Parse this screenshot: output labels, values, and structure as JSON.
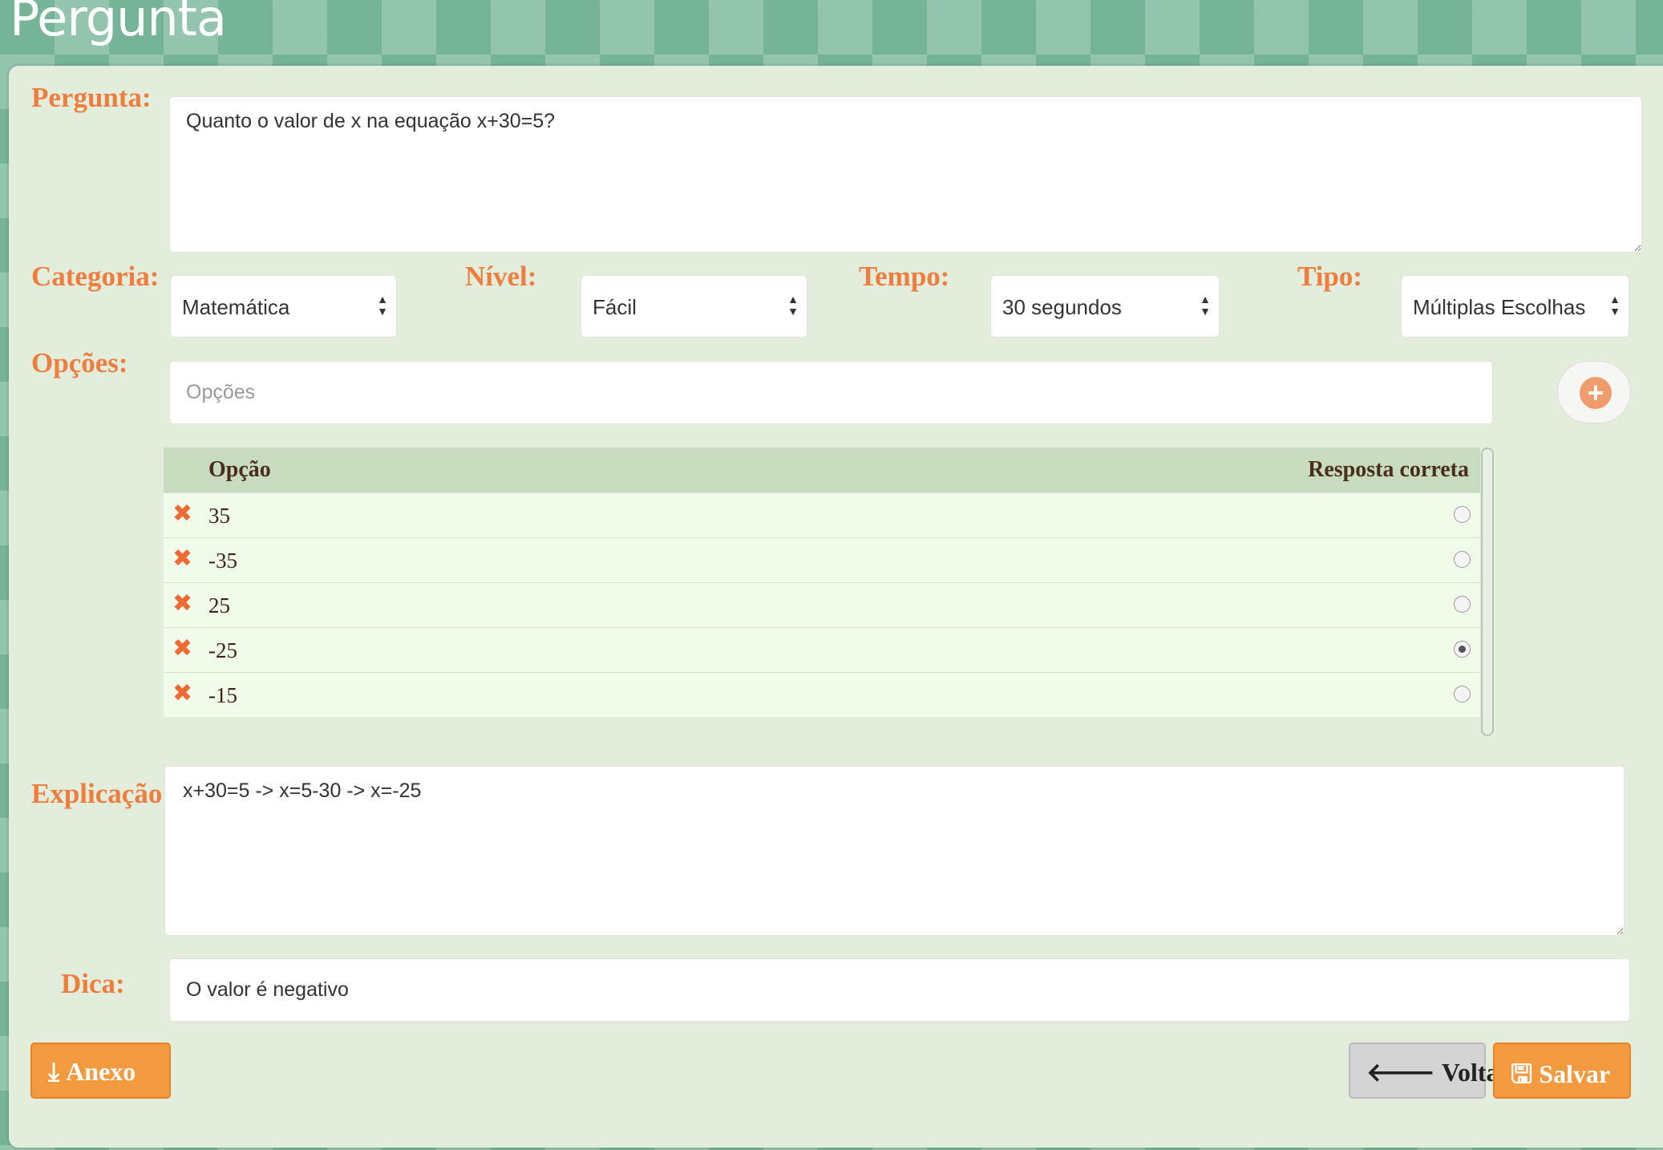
{
  "page": {
    "title": "Pergunta"
  },
  "question": {
    "label": "Pergunta:",
    "value": "Quanto o valor de x na equação x+30=5?"
  },
  "category": {
    "label": "Categoria:",
    "value": "Matemática"
  },
  "level": {
    "label": "Nível:",
    "value": "Fácil"
  },
  "time": {
    "label": "Tempo:",
    "value": "30 segundos"
  },
  "type": {
    "label": "Tipo:",
    "value": "Múltiplas Escolhas"
  },
  "options": {
    "label": "Opções:",
    "placeholder": "Opções",
    "add_icon": "plus-circle-icon",
    "delete_icon": "times-icon",
    "table": {
      "col_option": "Opção",
      "col_correct": "Resposta correta",
      "rows": [
        {
          "value": "35",
          "correct": false
        },
        {
          "value": "-35",
          "correct": false
        },
        {
          "value": "25",
          "correct": false
        },
        {
          "value": "-25",
          "correct": true
        },
        {
          "value": "-15",
          "correct": false
        }
      ]
    }
  },
  "explanation": {
    "label": "Explicação:",
    "value": "x+30=5 -> x=5-30 -> x=-25"
  },
  "hint": {
    "label": "Dica:",
    "value": "O valor é negativo"
  },
  "buttons": {
    "attachment": "Anexo",
    "attachment_icon": "download-icon",
    "back": "Voltar",
    "back_icon": "arrow-left-icon",
    "save": "Salvar",
    "save_icon": "floppy-disk-icon"
  },
  "colors": {
    "accent": "#ee7d3e",
    "panel": "#e2eedb",
    "background": "#75b497",
    "table_header": "#c8dbbe",
    "button_orange": "#f49a3e"
  }
}
